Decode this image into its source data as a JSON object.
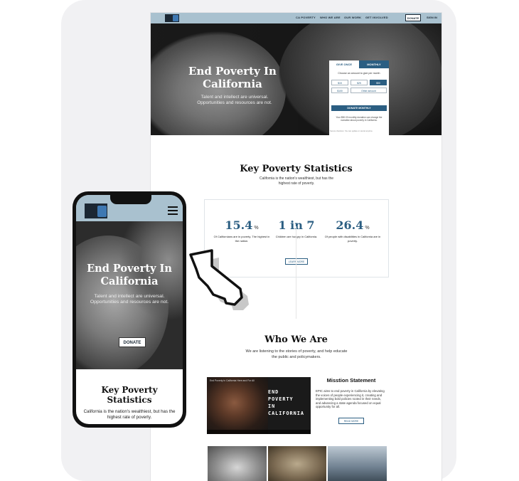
{
  "desktop": {
    "nav": {
      "links": [
        "CA POVERTY",
        "WHO WE ARE",
        "OUR WORK",
        "GET INVOLVED"
      ],
      "donate": "DONATE",
      "sign_in": "SIGN IN"
    },
    "hero": {
      "title": "End Poverty In California",
      "subtitle": "Talent and intellect are universal. Opportunities and resources are not."
    },
    "donation_form": {
      "tab_once": "GIVE ONCE",
      "tab_monthly": "MONTHLY",
      "prompt": "Choose an amount to give per month",
      "amounts": [
        "$15",
        "$25",
        "$50",
        "$100",
        "Other amount"
      ],
      "selected_amount": "$50",
      "cta": "DONATE MONTHLY",
      "note": "Your $50.00 monthly donation can change the narrative about poverty in California.",
      "fine_print": "Secure checkout. You can update or cancel anytime."
    },
    "stats": {
      "title": "Key Poverty Statistics",
      "tagline": "California is the nation's wealthiest, but has the highest rate of poverty.",
      "items": [
        {
          "value": "15.4",
          "unit": "%",
          "label": "Of Californians are in poverty. The highest in the nation."
        },
        {
          "value": "1 in 7",
          "unit": "",
          "label": "Children are hungry in California."
        },
        {
          "value": "26.4",
          "unit": "%",
          "label": "Of people with disabilities in California are in poverty."
        }
      ],
      "learn_more": "LEARN MORE"
    },
    "who": {
      "title": "Who We Are",
      "tagline": "We are listening to the stories of poverty, and help educate the public and policymakers.",
      "video_title": "End Poverty in California Here and For All",
      "video_words": [
        "END",
        "POVERTY",
        "IN",
        "CALIFORNIA"
      ],
      "mission_title": "Misstion Statement",
      "mission_text": "EPIC aims to end poverty in California by elevating the voices of people experiencing it, creating and implementing bold policies rooted in their needs, and advancing a state agenda focused on equal opportunity for all.",
      "read_more": "READ MORE"
    }
  },
  "mobile": {
    "hero": {
      "title": "End Poverty In California",
      "subtitle": "Talent and intellect are universal. Opportunities and resources are not.",
      "donate": "DONATE"
    },
    "stats": {
      "title": "Key Poverty Statistics",
      "tagline": "California is the nation's wealthiest, but has the highest rate of poverty."
    }
  },
  "colors": {
    "nav_bg": "#a9c1cf",
    "accent": "#2b5e82",
    "logo_blue": "#3e78b2"
  }
}
